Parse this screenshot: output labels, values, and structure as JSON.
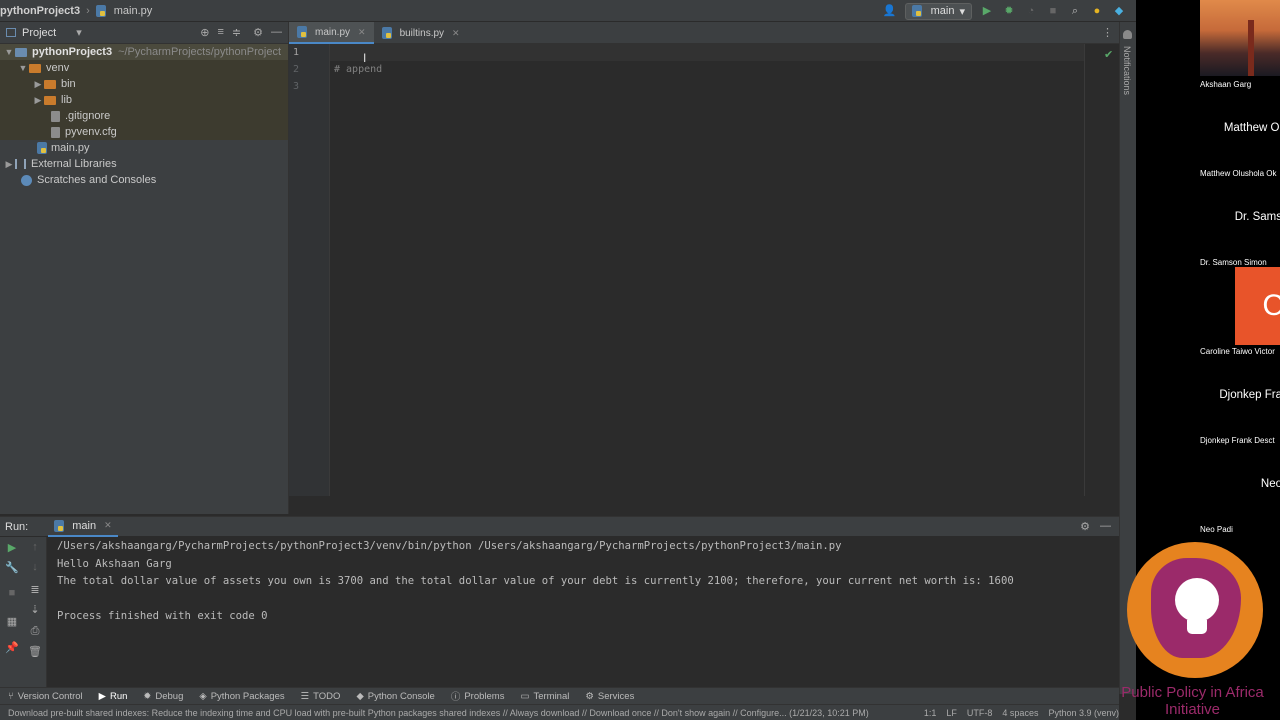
{
  "titlebar": {
    "project": "pythonProject3",
    "file": "main.py",
    "run_config": "main"
  },
  "project_panel": {
    "title": "Project",
    "root_name": "pythonProject3",
    "root_path": "~/PycharmProjects/pythonProject",
    "items": [
      {
        "label": "venv"
      },
      {
        "label": "bin"
      },
      {
        "label": "lib"
      },
      {
        "label": ".gitignore"
      },
      {
        "label": "pyvenv.cfg"
      },
      {
        "label": "main.py"
      },
      {
        "label": "External Libraries"
      },
      {
        "label": "Scratches and Consoles"
      }
    ]
  },
  "editor": {
    "tabs": [
      {
        "label": "main.py"
      },
      {
        "label": "builtins.py"
      }
    ],
    "line_numbers": [
      "1",
      "2",
      "3"
    ],
    "lines": [
      "",
      "# append",
      ""
    ]
  },
  "run_panel": {
    "label": "Run:",
    "tab": "main",
    "output": [
      "/Users/akshaangarg/PycharmProjects/pythonProject3/venv/bin/python /Users/akshaangarg/PycharmProjects/pythonProject3/main.py",
      "Hello Akshaan Garg",
      "The total dollar value of assets you own is 3700 and the total dollar value of your debt is currently 2100; therefore, your current net worth is: 1600",
      "",
      "Process finished with exit code 0"
    ]
  },
  "tool_windows": [
    {
      "label": "Version Control"
    },
    {
      "label": "Run"
    },
    {
      "label": "Debug"
    },
    {
      "label": "Python Packages"
    },
    {
      "label": "TODO"
    },
    {
      "label": "Python Console"
    },
    {
      "label": "Problems"
    },
    {
      "label": "Terminal"
    },
    {
      "label": "Services"
    }
  ],
  "statusbar": {
    "message": "Download pre-built shared indexes: Reduce the indexing time and CPU load with pre-built Python packages shared indexes // Always download // Download once // Don't show again // Configure... (1/21/23, 10:21 PM)",
    "position": "1:1",
    "line_sep": "LF",
    "encoding": "UTF-8",
    "indent": "4 spaces",
    "interpreter": "Python 3.9 (venv)"
  },
  "notifications_label": "Notifications",
  "participants": [
    {
      "name": "Akshaan Garg",
      "big": ""
    },
    {
      "name": "Matthew Olushola Ok",
      "big": "Matthew Ol"
    },
    {
      "name": "Dr. Samson Simon",
      "big": "Dr. Sams"
    },
    {
      "name": "Caroline Taiwo Victor",
      "big": "C"
    },
    {
      "name": "Djonkep Frank Desct",
      "big": "Djonkep Fra"
    },
    {
      "name": "Neo Padi",
      "big": "Neo"
    }
  ],
  "logo_text": "Public Policy in Africa Initiative",
  "colors": {
    "accent": "#4a88c7",
    "logo_orange": "#e6831f",
    "logo_purple": "#9b2a6a"
  }
}
